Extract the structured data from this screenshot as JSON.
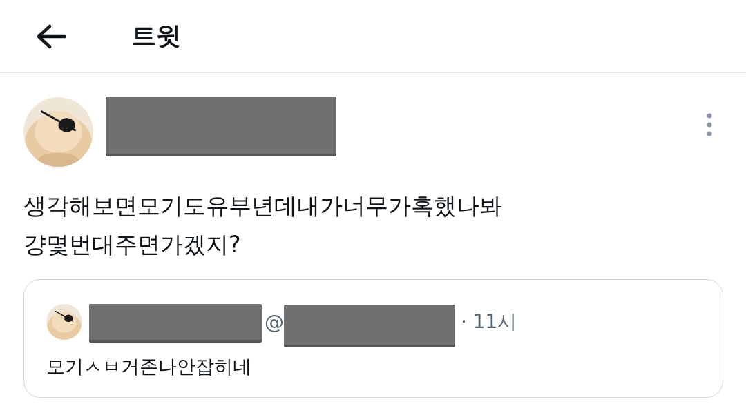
{
  "header": {
    "title": "트윗"
  },
  "tweet": {
    "text_lines": [
      "생각해보면모기도유부년데내가너무가혹했나봐",
      "걍몇번대주면가겠지?"
    ],
    "quote": {
      "handle_prefix": "@",
      "time": "· 11시",
      "text": "모기ㅅㅂ거존나안잡히네"
    }
  }
}
